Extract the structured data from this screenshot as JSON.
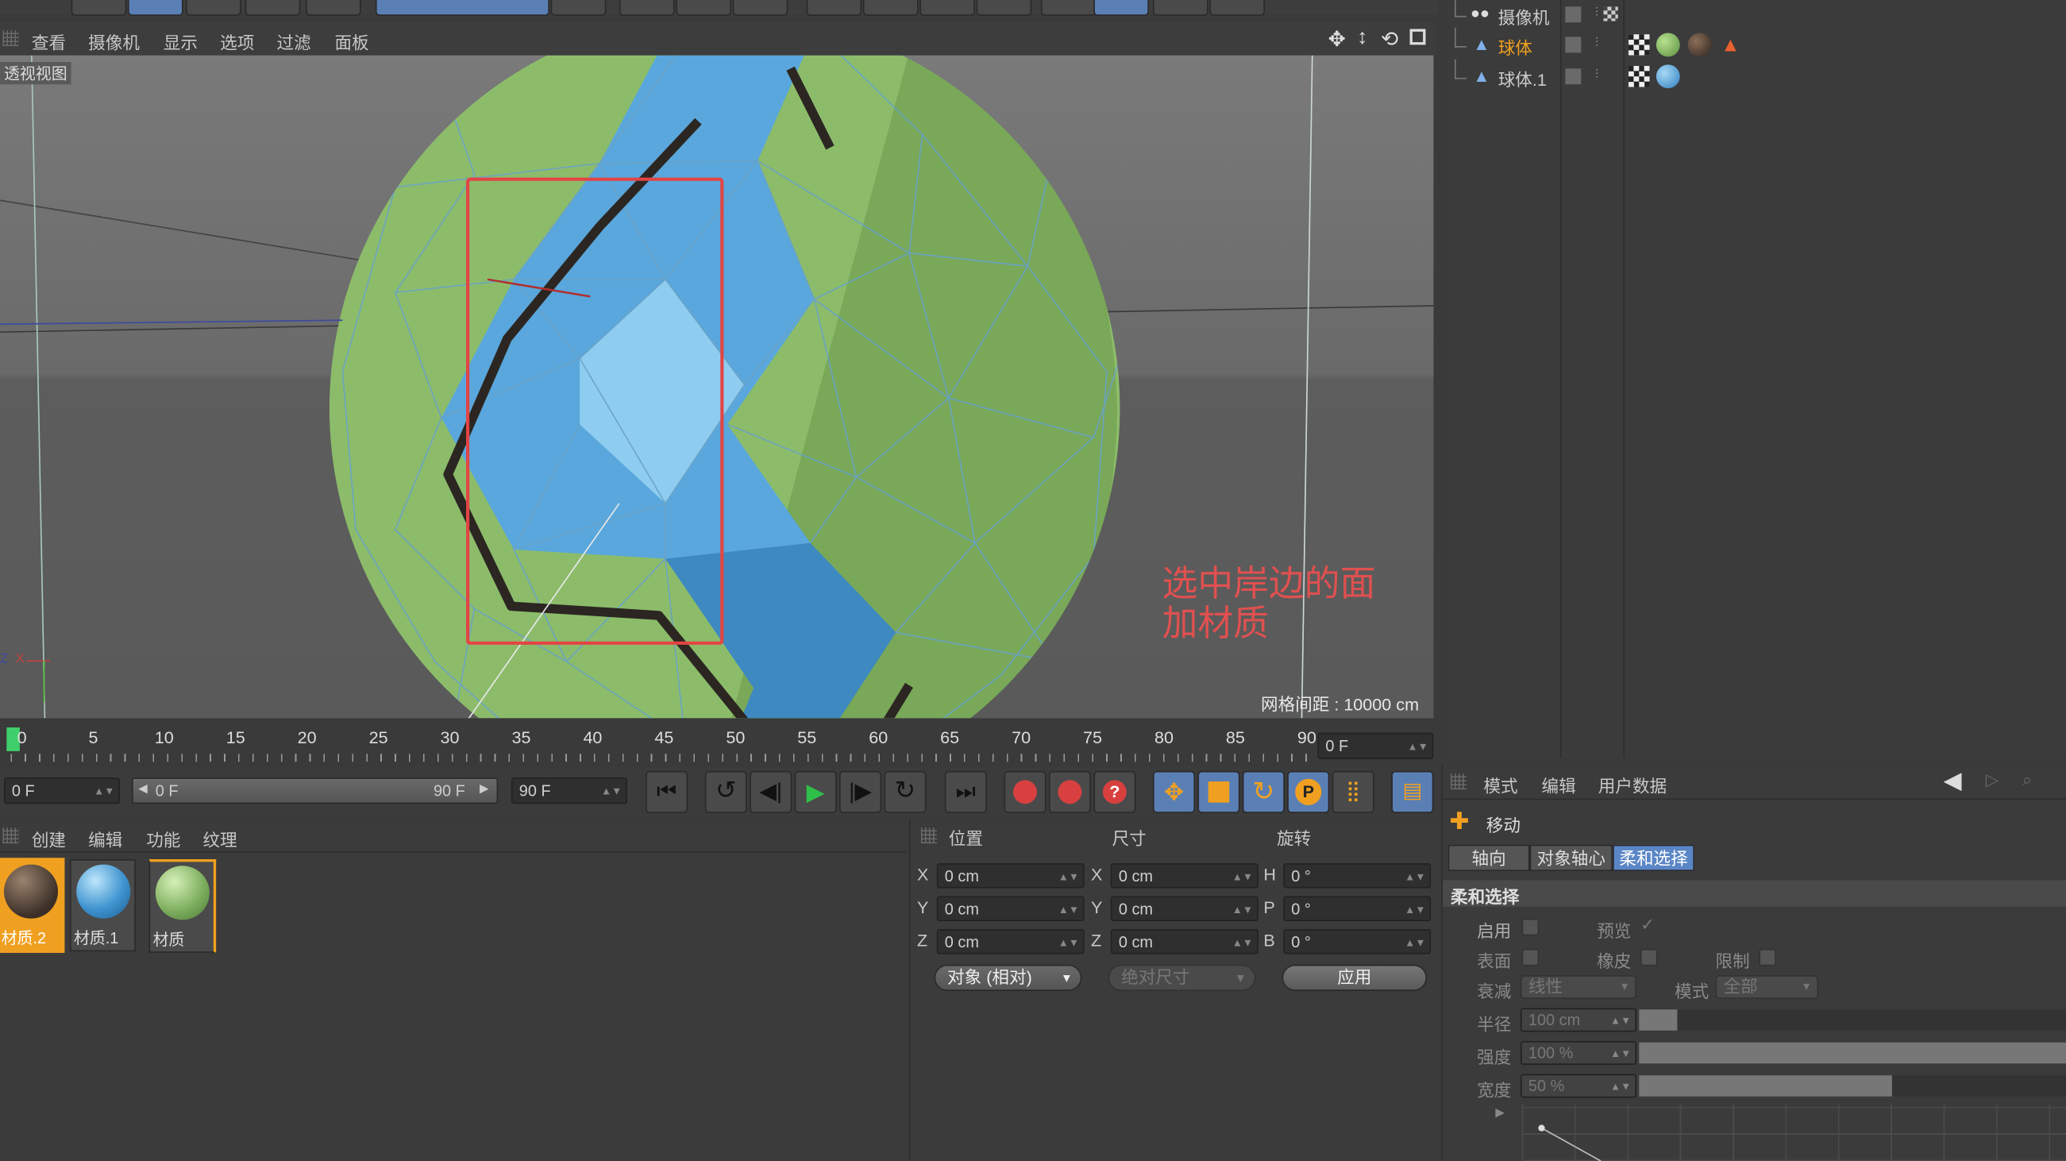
{
  "viewport": {
    "menu": [
      "查看",
      "摄像机",
      "显示",
      "选项",
      "过滤",
      "面板"
    ],
    "view_label": "透视视图",
    "annotation": [
      "选中岸边的面",
      "加材质"
    ],
    "grid_spacing": "网格间距 : 10000 cm",
    "axis_labels": {
      "z": "Z",
      "x": "X",
      "y": "Y"
    }
  },
  "objects": [
    {
      "name": "摄像机",
      "selected": false
    },
    {
      "name": "球体",
      "selected": true
    },
    {
      "name": "球体.1",
      "selected": false
    }
  ],
  "timeline": {
    "ticks": [
      "0",
      "5",
      "10",
      "15",
      "20",
      "25",
      "30",
      "35",
      "40",
      "45",
      "50",
      "55",
      "60",
      "65",
      "70",
      "75",
      "80",
      "85",
      "90"
    ],
    "current_frame": "0 F",
    "start_field": "0 F",
    "range_start": "0 F",
    "range_end": "90 F",
    "end_field": "90 F"
  },
  "materials": {
    "menu": [
      "创建",
      "编辑",
      "功能",
      "纹理"
    ],
    "items": [
      {
        "name": "材质.2",
        "color": "#5a4536",
        "selected": true
      },
      {
        "name": "材质.1",
        "color": "#3f94d0",
        "selected": false
      },
      {
        "name": "材质",
        "color": "#7fb060",
        "selected": false
      }
    ]
  },
  "coords": {
    "headers": [
      "位置",
      "尺寸",
      "旋转"
    ],
    "rows": [
      {
        "axis": "X",
        "pos": "0 cm",
        "size_axis": "X",
        "size": "0 cm",
        "rot_axis": "H",
        "rot": "0 °"
      },
      {
        "axis": "Y",
        "pos": "0 cm",
        "size_axis": "Y",
        "size": "0 cm",
        "rot_axis": "P",
        "rot": "0 °"
      },
      {
        "axis": "Z",
        "pos": "0 cm",
        "size_axis": "Z",
        "size": "0 cm",
        "rot_axis": "B",
        "rot": "0 °"
      }
    ],
    "mode_select": "对象 (相对)",
    "size_select": "绝对尺寸",
    "apply": "应用"
  },
  "attributes": {
    "menu": [
      "模式",
      "编辑",
      "用户数据"
    ],
    "tool_name": "移动",
    "tabs": [
      "轴向",
      "对象轴心",
      "柔和选择"
    ],
    "active_tab": 2,
    "section": "柔和选择",
    "enable": "启用",
    "preview": "预览",
    "preview_check": "✓",
    "surface": "表面",
    "rubber": "橡皮",
    "limit": "限制",
    "falloff": "衰减",
    "falloff_value": "线性",
    "mode": "模式",
    "mode_value": "全部",
    "radius": "半径",
    "radius_value": "100 cm",
    "radius_fill": 0.09,
    "strength": "强度",
    "strength_value": "100 %",
    "strength_fill": 1.0,
    "width": "宽度",
    "width_value": "50 %",
    "width_fill": 0.59
  }
}
